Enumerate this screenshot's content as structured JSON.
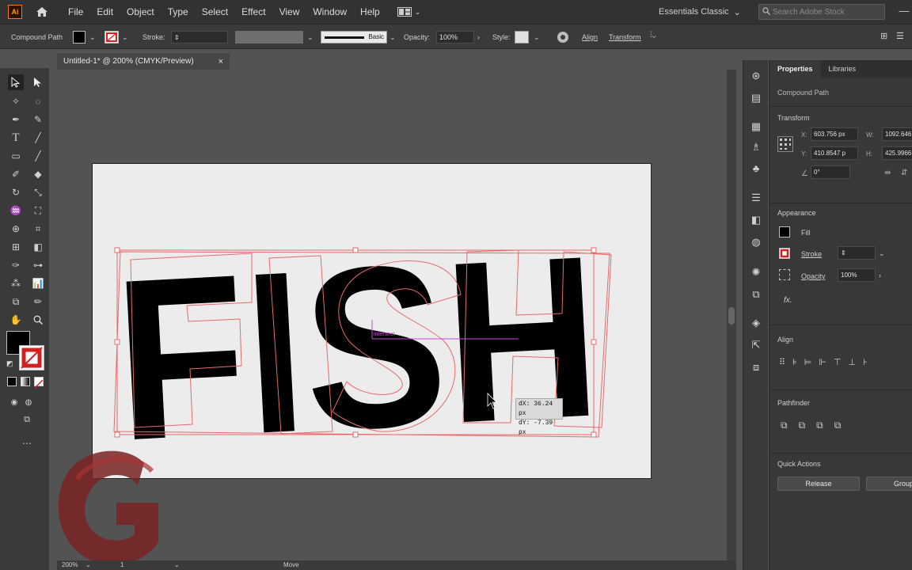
{
  "menubar": {
    "app_logo": "Ai",
    "items": [
      "File",
      "Edit",
      "Object",
      "Type",
      "Select",
      "Effect",
      "View",
      "Window",
      "Help"
    ],
    "workspace": "Essentials Classic",
    "search_placeholder": "Search Adobe Stock"
  },
  "controlbar": {
    "object_type": "Compound Path",
    "stroke_label": "Stroke:",
    "stroke_style": "Basic",
    "opacity_label": "Opacity:",
    "opacity_value": "100%",
    "style_label": "Style:",
    "align_label": "Align",
    "transform_label": "Transform"
  },
  "document": {
    "tab_title": "Untitled-1* @ 200% (CMYK/Preview)",
    "close_glyph": "×"
  },
  "canvas": {
    "artwork_text": "FISH",
    "smart_guide_label": "intersect",
    "measure_dx": "dX: 36.24 px",
    "measure_dy": "dY: -7.39 px"
  },
  "properties": {
    "tab_properties": "Properties",
    "tab_libraries": "Libraries",
    "object_type": "Compound Path",
    "transform_title": "Transform",
    "x_label": "X:",
    "x_value": "603.756 px",
    "y_label": "Y:",
    "y_value": "410.8547 p",
    "w_label": "W:",
    "w_value": "1092.646",
    "h_label": "H:",
    "h_value": "425.9966",
    "angle_value": "0°",
    "appearance_title": "Appearance",
    "fill_label": "Fill",
    "stroke_label": "Stroke",
    "opacity_label": "Opacity",
    "opacity_value": "100%",
    "fx_label": "fx.",
    "align_title": "Align",
    "pathfinder_title": "Pathfinder",
    "quick_actions_title": "Quick Actions",
    "release_button": "Release",
    "group_button": "Group"
  },
  "statusbar": {
    "zoom": "200%",
    "artboard_number": "1",
    "tool_name": "Move"
  },
  "colors": {
    "fill": "#000000",
    "artwork_outline": "#e8696b",
    "smart_guide": "#c44fd6",
    "logo_red": "#7a2323"
  },
  "icons": [
    "home-icon",
    "arrange-documents-icon",
    "search-icon",
    "minimize-icon",
    "maximize-icon",
    "close-icon",
    "selection-tool-icon",
    "direct-selection-tool-icon",
    "pen-tool-icon",
    "type-tool-icon",
    "rectangle-tool-icon",
    "paintbrush-tool-icon",
    "zoom-tool-icon",
    "hand-tool-icon"
  ]
}
